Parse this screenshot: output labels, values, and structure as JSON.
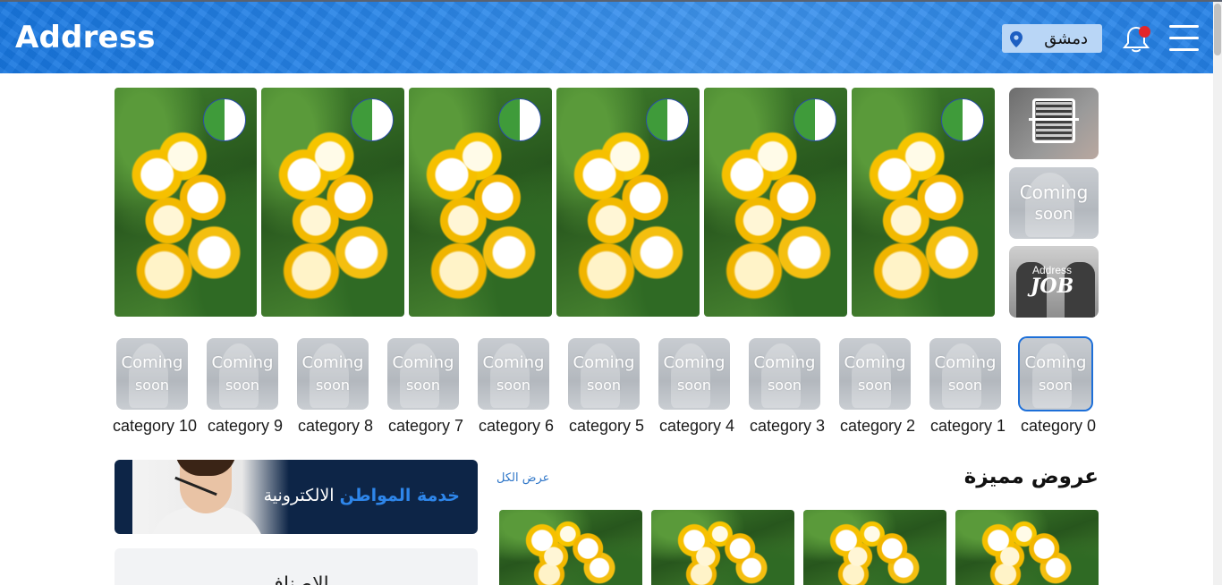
{
  "header": {
    "logo": "Address",
    "city": "دمشق",
    "icons": {
      "location": "map-pin-icon",
      "notifications": "bell-icon",
      "menu": "hamburger-menu-icon"
    },
    "colors": {
      "primary": "#2a86e8",
      "notification_dot": "#e3262a"
    }
  },
  "slider": {
    "cards": [
      {
        "image": "plumeria-flowers",
        "badge": "flag"
      },
      {
        "image": "plumeria-flowers",
        "badge": "flag"
      },
      {
        "image": "plumeria-flowers",
        "badge": "flag"
      },
      {
        "image": "plumeria-flowers",
        "badge": "flag"
      },
      {
        "image": "plumeria-flowers",
        "badge": "flag"
      },
      {
        "image": "plumeria-flowers",
        "badge": "flag"
      }
    ]
  },
  "side_tiles": {
    "qr_scan": "qr-scan-icon",
    "coming_soon": {
      "line1": "Coming",
      "line2": "soon"
    },
    "job": {
      "brand": "Address",
      "text": "JOB"
    }
  },
  "categories": [
    {
      "label": "category 10",
      "line1": "Coming",
      "line2": "soon",
      "selected": false
    },
    {
      "label": "category 9",
      "line1": "Coming",
      "line2": "soon",
      "selected": false
    },
    {
      "label": "category 8",
      "line1": "Coming",
      "line2": "soon",
      "selected": false
    },
    {
      "label": "category 7",
      "line1": "Coming",
      "line2": "soon",
      "selected": false
    },
    {
      "label": "category 6",
      "line1": "Coming",
      "line2": "soon",
      "selected": false
    },
    {
      "label": "category 5",
      "line1": "Coming",
      "line2": "soon",
      "selected": false
    },
    {
      "label": "category 4",
      "line1": "Coming",
      "line2": "soon",
      "selected": false
    },
    {
      "label": "category 3",
      "line1": "Coming",
      "line2": "soon",
      "selected": false
    },
    {
      "label": "category 2",
      "line1": "Coming",
      "line2": "soon",
      "selected": false
    },
    {
      "label": "category 1",
      "line1": "Coming",
      "line2": "soon",
      "selected": false
    },
    {
      "label": "category 0",
      "line1": "Coming",
      "line2": "soon",
      "selected": true
    }
  ],
  "banner": {
    "highlight": "خدمة المواطن",
    "rest": "الالكترونية",
    "highlight_color": "#2e86ea",
    "background": "#0d2547"
  },
  "panel": {
    "title": "الاصناف"
  },
  "offers": {
    "title": "عروض مميزة",
    "view_all": "عرض الكل",
    "items": [
      {
        "image": "plumeria-flowers"
      },
      {
        "image": "plumeria-flowers"
      },
      {
        "image": "plumeria-flowers"
      },
      {
        "image": "plumeria-flowers"
      }
    ]
  }
}
